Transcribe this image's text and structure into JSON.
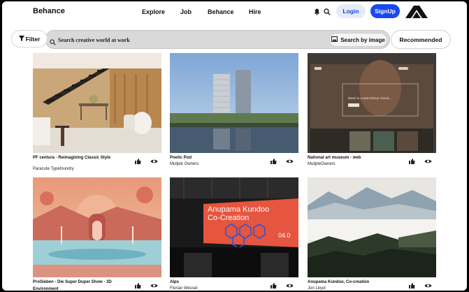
{
  "header": {
    "logo": "Behance",
    "nav": [
      "Explore",
      "Job",
      "Behance",
      "Hire"
    ],
    "login_label": "Login",
    "signup_label": "SignUp"
  },
  "search": {
    "filter_label": "Filter",
    "placeholder": "Search creative world at work",
    "image_search_label": "Search by image",
    "sort_label": "Recommended"
  },
  "projects": [
    {
      "title": "PF centura - Reimagining Classic Style",
      "owner": "Paracute Typefoundry",
      "image": "modern interior with staircase"
    },
    {
      "title": "Poetic Pod",
      "owner": "Muliple Owners",
      "image": "twin towers by the water"
    },
    {
      "title": "National art museum - web",
      "owner": "MulipleOwners",
      "image": "museum website mockup"
    },
    {
      "title": "ProSieben - Die Super Duper Show - 3D Environment",
      "owner": "",
      "image": "pink 3D landscape"
    },
    {
      "title": "Alps",
      "owner": "Florian Wessel",
      "image": "orange digital billboard"
    },
    {
      "title": "Anupama Kundoo, Co-creation",
      "owner": "Jon Lloyd",
      "image": "misty mountain forest"
    }
  ],
  "artwork_text": {
    "billboard_line1": "Anupama Kundoo",
    "billboard_line2": "Co-Creation",
    "billboard_num": "04.0",
    "museum_headline": "there is a marvelous cloud..."
  },
  "colors": {
    "accent": "#1b48ee",
    "login_bg": "#e5ebf9"
  }
}
